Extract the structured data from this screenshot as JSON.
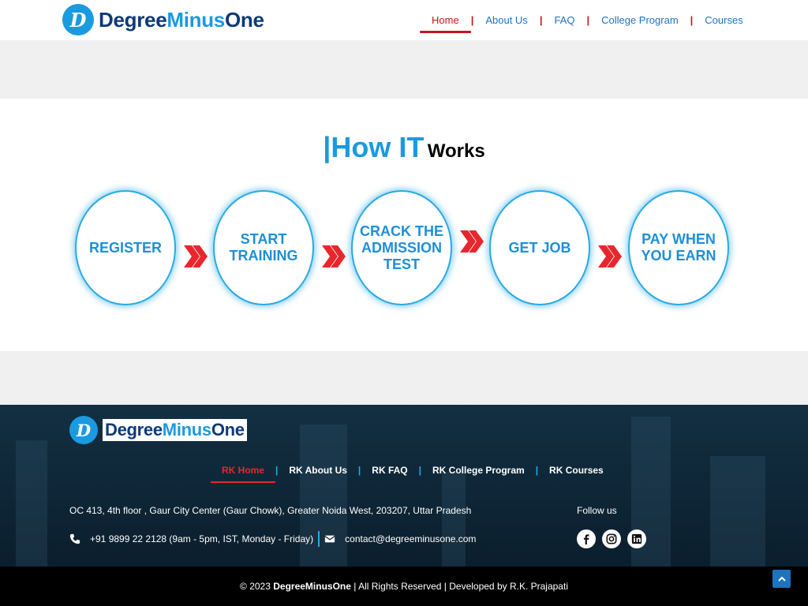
{
  "header": {
    "logo": {
      "part1": "Degree",
      "part2": "Minus",
      "part3": "One",
      "mark": "D"
    },
    "nav": [
      {
        "label": "Home",
        "active": true
      },
      {
        "label": "About Us"
      },
      {
        "label": "FAQ"
      },
      {
        "label": "College Program"
      },
      {
        "label": "Courses"
      }
    ]
  },
  "how": {
    "title_bar": "|",
    "title_big": "How IT",
    "title_small": "Works",
    "steps": [
      "REGISTER",
      "START\nTRAINING",
      "CRACK THE\nADMISSION\nTEST",
      "GET JOB",
      "PAY WHEN\nYOU EARN"
    ]
  },
  "footer": {
    "logo": {
      "part1": "Degree",
      "part2": "Minus",
      "part3": "One",
      "mark": "D"
    },
    "nav": [
      {
        "label": "RK Home",
        "active": true
      },
      {
        "label": "RK About Us"
      },
      {
        "label": "RK FAQ"
      },
      {
        "label": "RK College Program"
      },
      {
        "label": "RK Courses"
      }
    ],
    "address": "OC 413, 4th floor , Gaur City Center (Gaur Chowk), Greater Noida West, 203207, Uttar Pradesh",
    "phone": "+91 9899 22 2128 (9am - 5pm, IST, Monday - Friday)",
    "email": "contact@degreeminusone.com",
    "follow_label": "Follow us",
    "social_icons": [
      "facebook-icon",
      "instagram-icon",
      "linkedin-icon"
    ]
  },
  "bottom": {
    "copyright": "© 2023",
    "brand": "DegreeMinusOne",
    "rest": "| All Rights Reserved | Developed by R.K. Prajapati"
  },
  "colors": {
    "brand_blue": "#1a9ae0",
    "brand_navy": "#0d3a78",
    "accent_red": "#c4161c",
    "footer_bg": "#0f2533"
  }
}
